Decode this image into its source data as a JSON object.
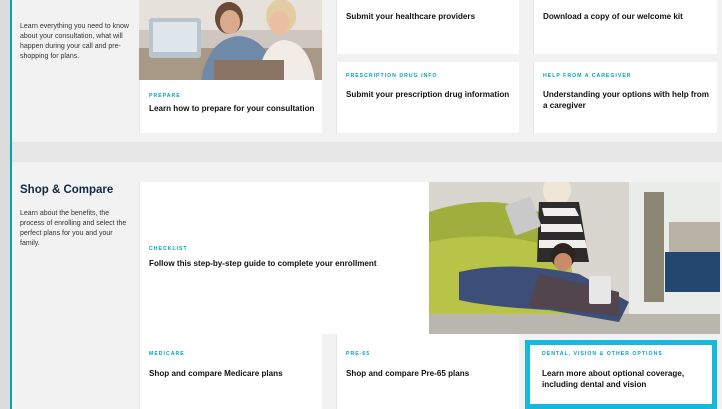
{
  "prepare_section": {
    "description": "Learn everything you need to know about your consultation, what will happen during your call and pre-shopping for plans.",
    "cards": [
      {
        "eyebrow": "PREPARE",
        "title": "Learn how to prepare for your consultation"
      },
      {
        "eyebrow": "",
        "title": "Submit your healthcare providers"
      },
      {
        "eyebrow": "",
        "title": "Download a copy of our welcome kit"
      },
      {
        "eyebrow": "PRESCRIPTION DRUG INFO",
        "title": "Submit your prescription drug information"
      },
      {
        "eyebrow": "HELP FROM A CAREGIVER",
        "title": "Understanding your options with help from a caregiver"
      }
    ]
  },
  "shop_section": {
    "title": "Shop & Compare",
    "description": "Learn about the benefits, the process of enrolling and select the perfect plans for you and your family.",
    "checklist": {
      "eyebrow": "CHECKLIST",
      "title": "Follow this step-by-step guide to complete your enrollment"
    },
    "cards": [
      {
        "eyebrow": "MEDICARE",
        "title": "Shop and compare Medicare plans"
      },
      {
        "eyebrow": "PRE-65",
        "title": "Shop and compare Pre-65 plans"
      },
      {
        "eyebrow": "DENTAL, VISION & OTHER OPTIONS",
        "title": "Learn more about optional coverage, including dental and vision"
      }
    ]
  },
  "colors": {
    "accent": "#00a3c4",
    "highlight": "#17b8dd",
    "heading": "#0d2a45"
  }
}
